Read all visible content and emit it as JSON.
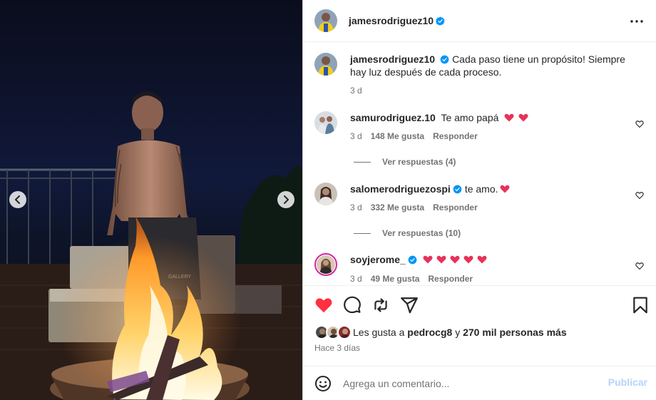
{
  "post": {
    "author": "jamesrodriguez10",
    "verified": true,
    "caption": "Cada paso tiene un propósito! Siempre hay luz después de cada proceso.",
    "caption_time": "3 d",
    "more_icon": "more-horizontal-icon"
  },
  "comments": [
    {
      "user": "samurodriguez.10",
      "verified": false,
      "text": "Te amo papá",
      "emoji_hearts": 2,
      "time": "3 d",
      "likes": "148 Me gusta",
      "reply": "Responder",
      "view_replies": "Ver respuestas (4)"
    },
    {
      "user": "salomerodriguezospi",
      "verified": true,
      "text": "te amo.",
      "emoji_hearts": 1,
      "time": "3 d",
      "likes": "332 Me gusta",
      "reply": "Responder",
      "view_replies": "Ver respuestas (10)"
    },
    {
      "user": "soyjerome_",
      "verified": true,
      "text": "",
      "emoji_hearts": 5,
      "time": "3 d",
      "likes": "49 Me gusta",
      "reply": "Responder"
    }
  ],
  "actions": {
    "like_icon": "heart-filled-icon",
    "comment_icon": "comment-icon",
    "share_icon": "repost-icon",
    "send_icon": "send-icon",
    "save_icon": "bookmark-icon",
    "liked": true
  },
  "likes": {
    "prefix": "Les gusta a",
    "user": "pedrocg8",
    "joiner": "y",
    "others": "270 mil personas más"
  },
  "time_ago": "Hace 3 días",
  "comment_box": {
    "placeholder": "Agrega un comentario...",
    "publish": "Publicar"
  },
  "colors": {
    "like_red": "#ff3040",
    "verified_blue": "#0095f6",
    "publish_disabled": "#b3d4f8",
    "muted": "#737373"
  }
}
